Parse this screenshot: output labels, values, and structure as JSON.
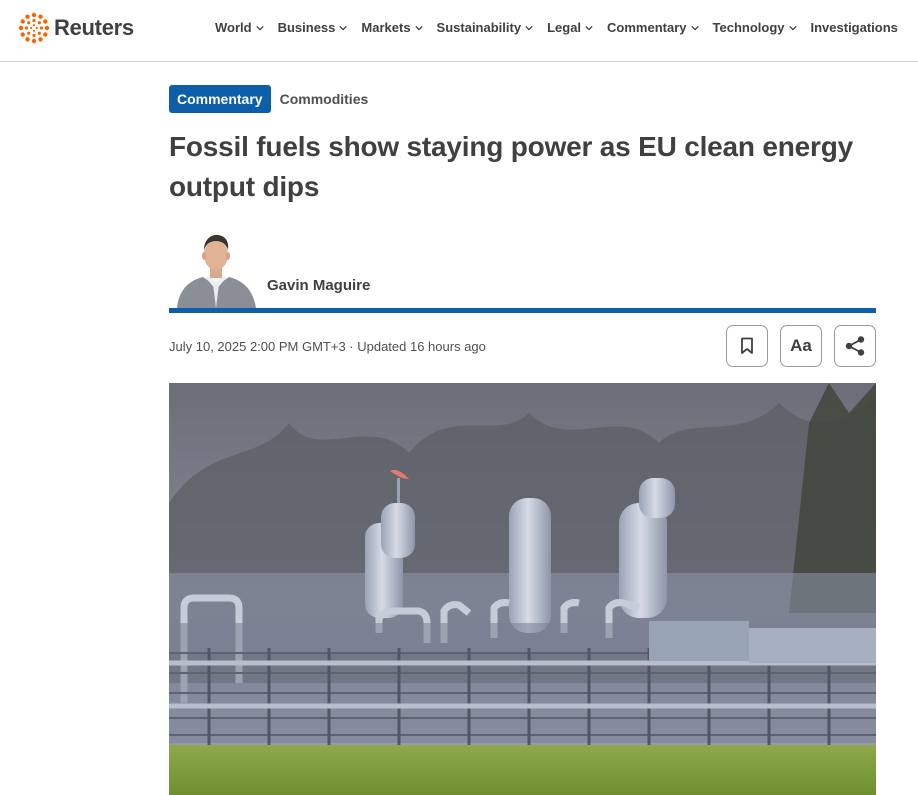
{
  "header": {
    "brand": "Reuters",
    "brand_color": "#fa6400",
    "nav": [
      {
        "label": "World",
        "has_dropdown": true
      },
      {
        "label": "Business",
        "has_dropdown": true
      },
      {
        "label": "Markets",
        "has_dropdown": true
      },
      {
        "label": "Sustainability",
        "has_dropdown": true
      },
      {
        "label": "Legal",
        "has_dropdown": true
      },
      {
        "label": "Commentary",
        "has_dropdown": true
      },
      {
        "label": "Technology",
        "has_dropdown": true
      },
      {
        "label": "Investigations",
        "has_dropdown": false
      }
    ]
  },
  "article": {
    "tags": {
      "primary": "Commentary",
      "secondary": "Commodities"
    },
    "accent_color": "#0c5fa8",
    "headline": "Fossil fuels show staying power as EU clean energy output dips",
    "author": "Gavin Maguire",
    "dateline": "July 10, 2025 2:00 PM GMT+3 · Updated 16 hours ago",
    "tools": {
      "bookmark_icon": "bookmark-icon",
      "text_size_label": "Aa",
      "share_icon": "share-icon"
    }
  }
}
